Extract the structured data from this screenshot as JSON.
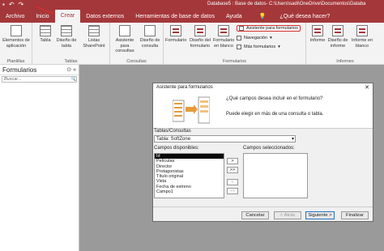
{
  "window": {
    "qat_save_icon": "floppy-disk-icon",
    "qat_undo": "↶",
    "qat_redo": "↷",
    "doc_title": "Database5 : Base de datos- C:\\Users\\sadi\\OneDrive\\Documentos\\Databa"
  },
  "menu": {
    "items": [
      "Archivo",
      "Inicio",
      "Crear",
      "Datos externos",
      "Herramientas de base de datos",
      "Ayuda"
    ],
    "active": "Crear",
    "tell_me_icon": "💡",
    "tell_me": "¿Qué desea hacer?"
  },
  "ribbon": {
    "groups": [
      "Plantillas",
      "Tablas",
      "Consultas",
      "Formularios",
      "Informes"
    ],
    "app_parts": "Elementos de aplicación",
    "table": "Tabla",
    "table_design": "Diseño de tabla",
    "sharepoint": "Listas SharePoint",
    "query_wizard": "Asistente para consultas",
    "query_design": "Diseño de consulta",
    "form": "Formulario",
    "form_design": "Diseño del formulario",
    "blank_form": "Formulario en blanco",
    "form_wizard": "Asistente para formularios",
    "navigation": "Navegación",
    "more_forms": "Más formularios",
    "report": "Informe",
    "report_design": "Diseño de informe",
    "blank_report": "Informe en blanco"
  },
  "nav": {
    "title": "Formularios",
    "search": "Buscar...",
    "search_icon": "🔍"
  },
  "dialog": {
    "title": "Asistente para formularios",
    "q1": "¿Qué campos desea incluir en el formulario?",
    "q2": "Puede elegir en más de una consulta o tabla.",
    "tables_label": "Tablas/Consultas",
    "table_value": "Tabla: SoftZone",
    "available_label": "Campos disponibles:",
    "selected_label": "Campos seleccionados:",
    "available": [
      "Id",
      "Películas",
      "Director",
      "Protagonistas",
      "Título original",
      "Vista",
      "Fecha de estreno",
      "Campo1"
    ],
    "selected_index": 0,
    "move_one": ">",
    "move_all": ">>",
    "remove_one": "<",
    "remove_all": "<<",
    "cancel": "Cancelar",
    "back": "< Atrás",
    "next": "Siguiente >",
    "finish": "Finalizar"
  },
  "colors": {
    "accent": "#a4373a",
    "highlight": "#d32f2f",
    "primary_button": "#2672c7"
  }
}
